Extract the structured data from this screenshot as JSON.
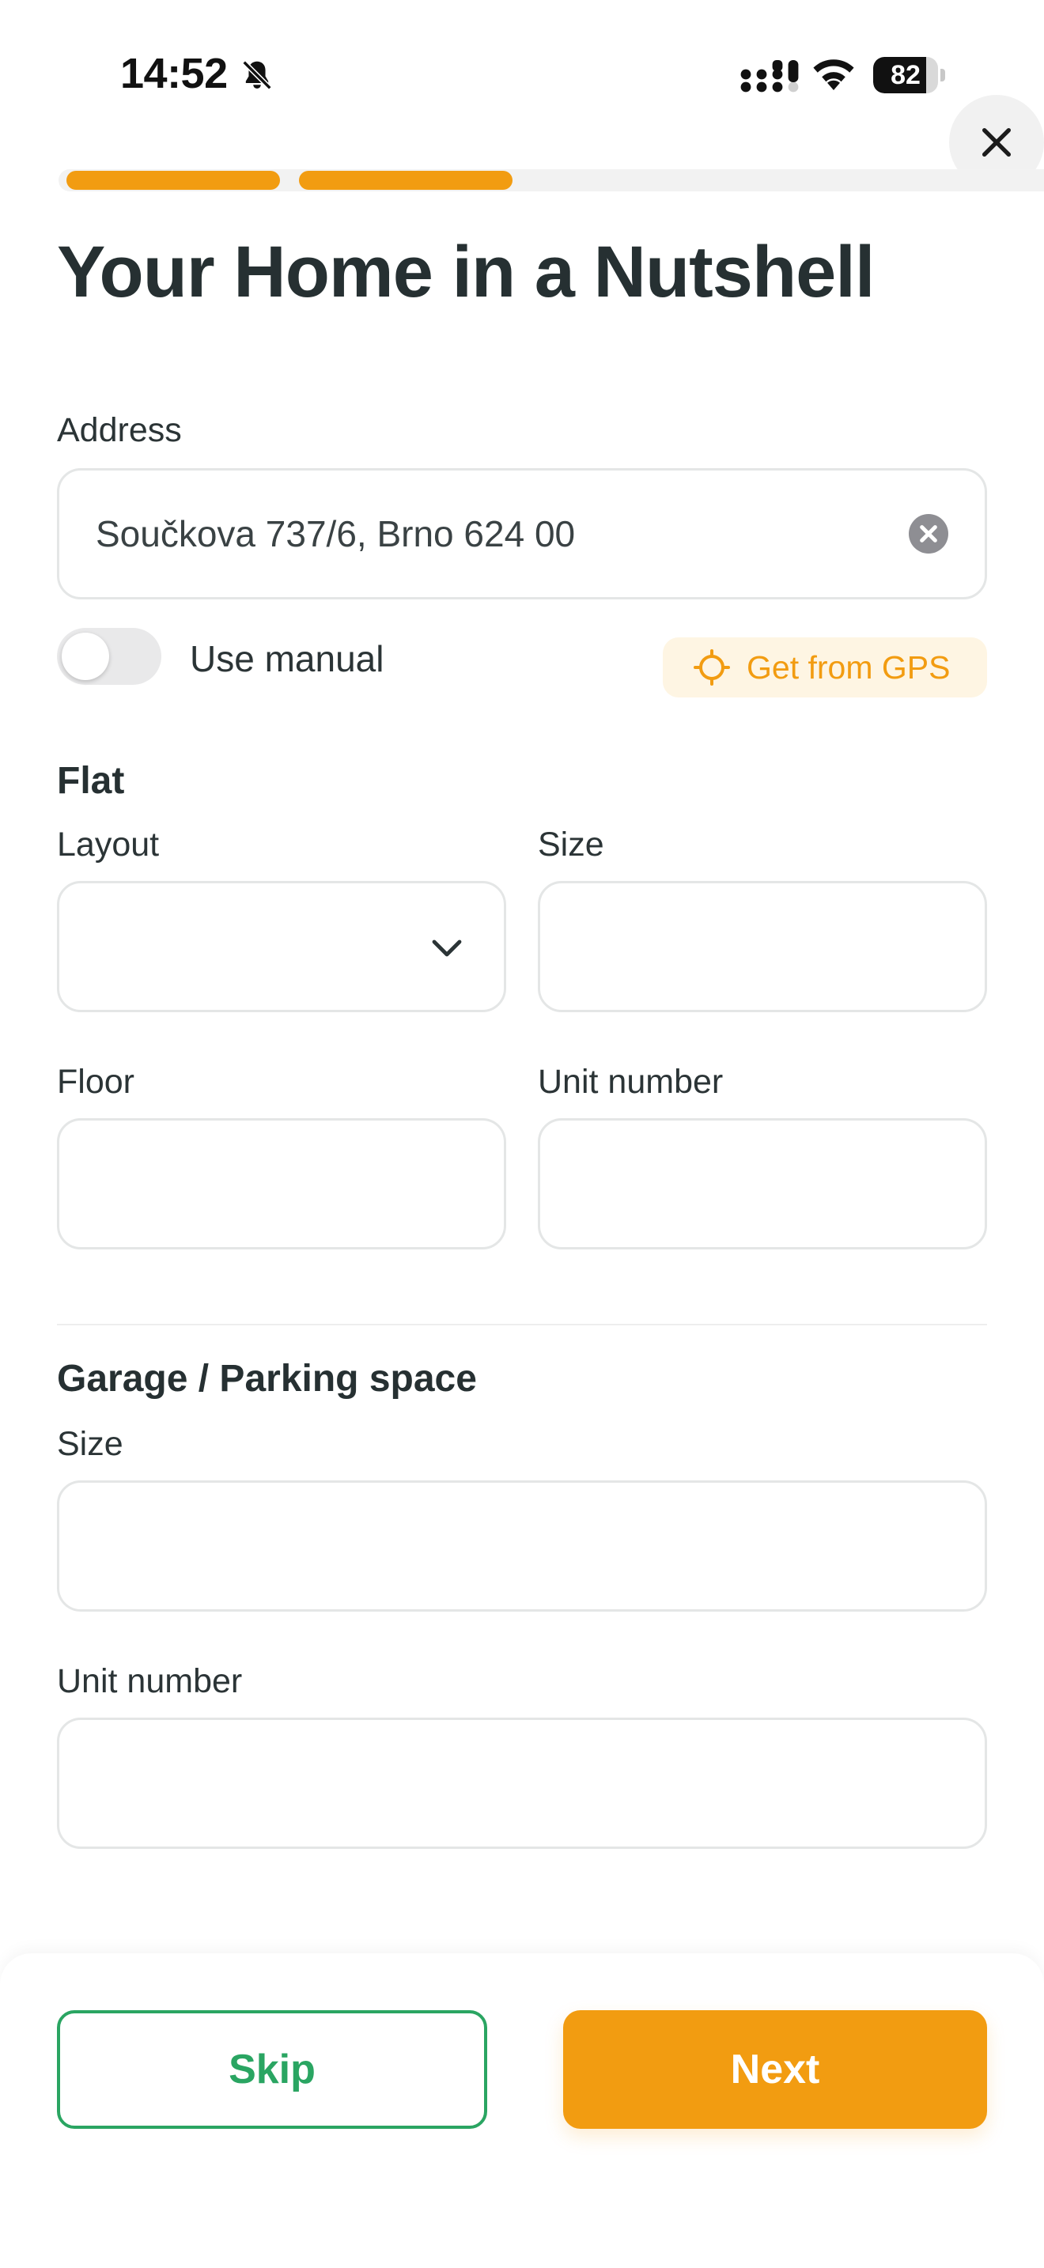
{
  "status_bar": {
    "time": "14:52",
    "battery_percent": 82,
    "battery_label": "82"
  },
  "onboarding": {
    "progress": {
      "completed_steps": 2
    }
  },
  "page": {
    "title": "Your Home in a Nutshell"
  },
  "address": {
    "label": "Address",
    "value": "Součkova 737/6, Brno 624 00",
    "manual_toggle_label": "Use manual",
    "manual_toggle_on": false,
    "gps_button_label": "Get from GPS"
  },
  "flat": {
    "section_title": "Flat",
    "layout_label": "Layout",
    "size_label": "Size",
    "floor_label": "Floor",
    "unit_number_label": "Unit number"
  },
  "garage": {
    "section_title": "Garage / Parking space",
    "size_label": "Size",
    "unit_number_label": "Unit number"
  },
  "actions": {
    "skip_label": "Skip",
    "next_label": "Next"
  },
  "colors": {
    "accent": "#f29c11",
    "success": "#2aa562",
    "text_dark": "#263032"
  }
}
